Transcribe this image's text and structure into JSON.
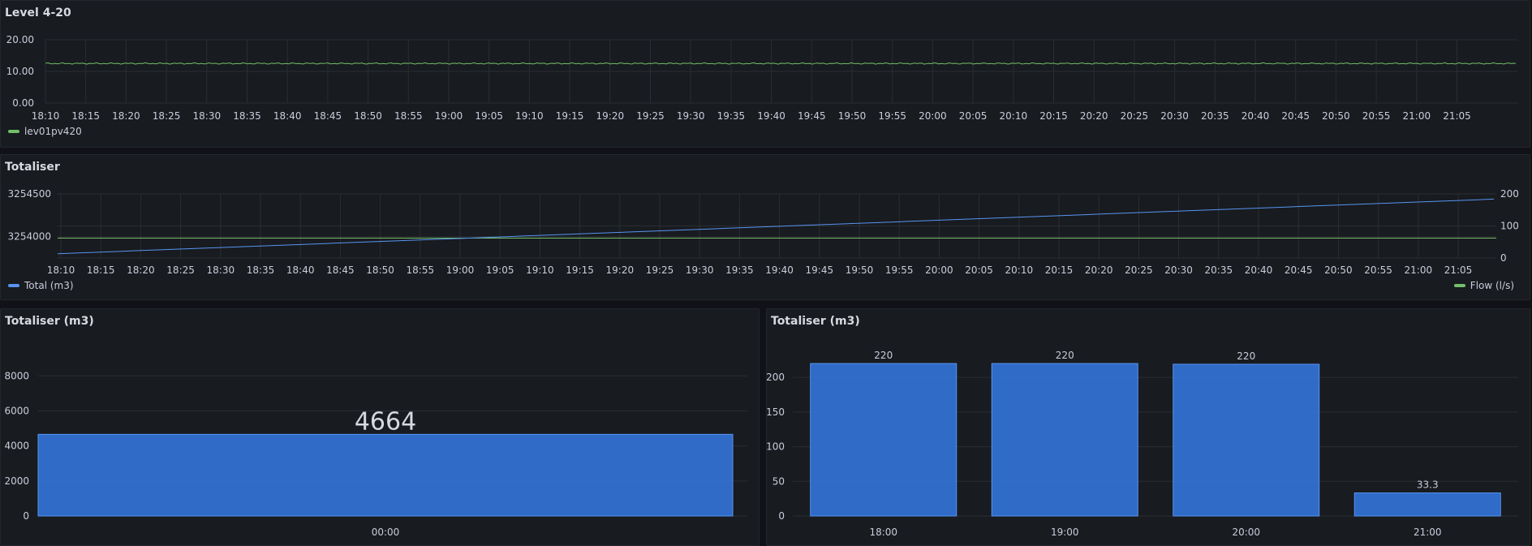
{
  "colors": {
    "green": "#73bf69",
    "blue": "#5794f2",
    "bar": "#3274d9",
    "grid": "#2a2d33",
    "text": "#ccccdc"
  },
  "time_ticks": [
    "18:10",
    "18:15",
    "18:20",
    "18:25",
    "18:30",
    "18:35",
    "18:40",
    "18:45",
    "18:50",
    "18:55",
    "19:00",
    "19:05",
    "19:10",
    "19:15",
    "19:20",
    "19:25",
    "19:30",
    "19:35",
    "19:40",
    "19:45",
    "19:50",
    "19:55",
    "20:00",
    "20:05",
    "20:10",
    "20:15",
    "20:20",
    "20:25",
    "20:30",
    "20:35",
    "20:40",
    "20:45",
    "20:50",
    "20:55",
    "21:00",
    "21:05"
  ],
  "level_panel": {
    "title": "Level 4-20",
    "legend": "lev01pv420",
    "y_ticks": [
      "20.00",
      "10.00",
      "0.00"
    ],
    "chart_data": {
      "type": "line",
      "series": [
        {
          "name": "lev01pv420",
          "value": 12.5
        }
      ],
      "ylim": [
        0,
        20
      ]
    }
  },
  "totaliser_panel": {
    "title": "Totaliser",
    "legend_left": "Total (m3)",
    "legend_right": "Flow (l/s)",
    "y_ticks_left": [
      "3254500",
      "3254000"
    ],
    "y_ticks_right": [
      "200",
      "100",
      "0"
    ],
    "chart_data": {
      "type": "line",
      "series": [
        {
          "name": "Total (m3)",
          "start": 3253800,
          "end": 3254440,
          "axis": "left"
        },
        {
          "name": "Flow (l/s)",
          "value": 62,
          "axis": "right"
        }
      ],
      "ylim_left": [
        3253750,
        3254500
      ],
      "ylim_right": [
        0,
        200
      ]
    }
  },
  "total_stat_panel": {
    "title": "Totaliser (m3)",
    "y_ticks": [
      "8000",
      "6000",
      "4000",
      "2000",
      "0"
    ],
    "chart_data": {
      "type": "bar",
      "categories": [
        "00:00"
      ],
      "values": [
        4664
      ],
      "value_labels": [
        "4664"
      ],
      "ylim": [
        0,
        9500
      ]
    }
  },
  "hourly_panel": {
    "title": "Totaliser (m3)",
    "y_ticks": [
      "200",
      "150",
      "100",
      "50",
      "0"
    ],
    "chart_data": {
      "type": "bar",
      "categories": [
        "18:00",
        "19:00",
        "20:00",
        "21:00"
      ],
      "values": [
        220,
        220,
        219,
        33.3
      ],
      "value_labels": [
        "220",
        "220",
        "220",
        "33.3"
      ],
      "ylim": [
        0,
        240
      ]
    }
  }
}
